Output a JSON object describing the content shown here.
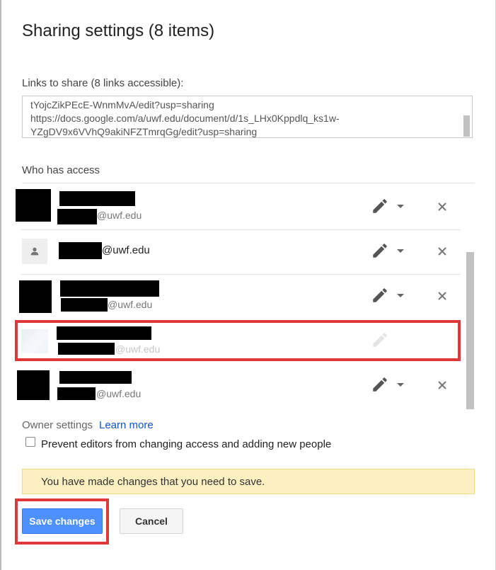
{
  "dialog": {
    "title": "Sharing settings (8 items)",
    "links_label": "Links to share (8 links accessible):",
    "links_text": "tYojcZikPEcE-WnmMvA/edit?usp=sharing\nhttps://docs.google.com/a/uwf.edu/document/d/1s_LHx0Kppdlq_ks1w-\nYZgDV9x6VVhQ9akiNFZTmrqGg/edit?usp=sharing",
    "access_label": "Who has access"
  },
  "people": [
    {
      "email_suffix": "@uwf.edu",
      "permission_icon": "pencil-icon",
      "removable": true
    },
    {
      "email_suffix": "@uwf.edu",
      "permission_icon": "pencil-icon",
      "removable": true,
      "avatar": "person-icon"
    },
    {
      "email_suffix": "@uwf.edu",
      "permission_icon": "pencil-icon",
      "removable": true
    },
    {
      "email_suffix": "@uwf.edu",
      "permission_icon": "pencil-icon",
      "removable": false,
      "state": "disabled"
    },
    {
      "email_suffix": "@uwf.edu",
      "permission_icon": "pencil-icon",
      "removable": true
    }
  ],
  "owner_settings": {
    "label": "Owner settings",
    "learn_more": "Learn more",
    "prevent_editors_label": "Prevent editors from changing access and adding new people",
    "prevent_editors_checked": false
  },
  "banner": {
    "text": "You have made changes that you need to save."
  },
  "buttons": {
    "save": "Save changes",
    "cancel": "Cancel"
  },
  "colors": {
    "primary_button": "#4d90fe",
    "highlight_outline": "#e0373b",
    "link": "#1155cc",
    "banner_bg": "#fcf0c1"
  }
}
